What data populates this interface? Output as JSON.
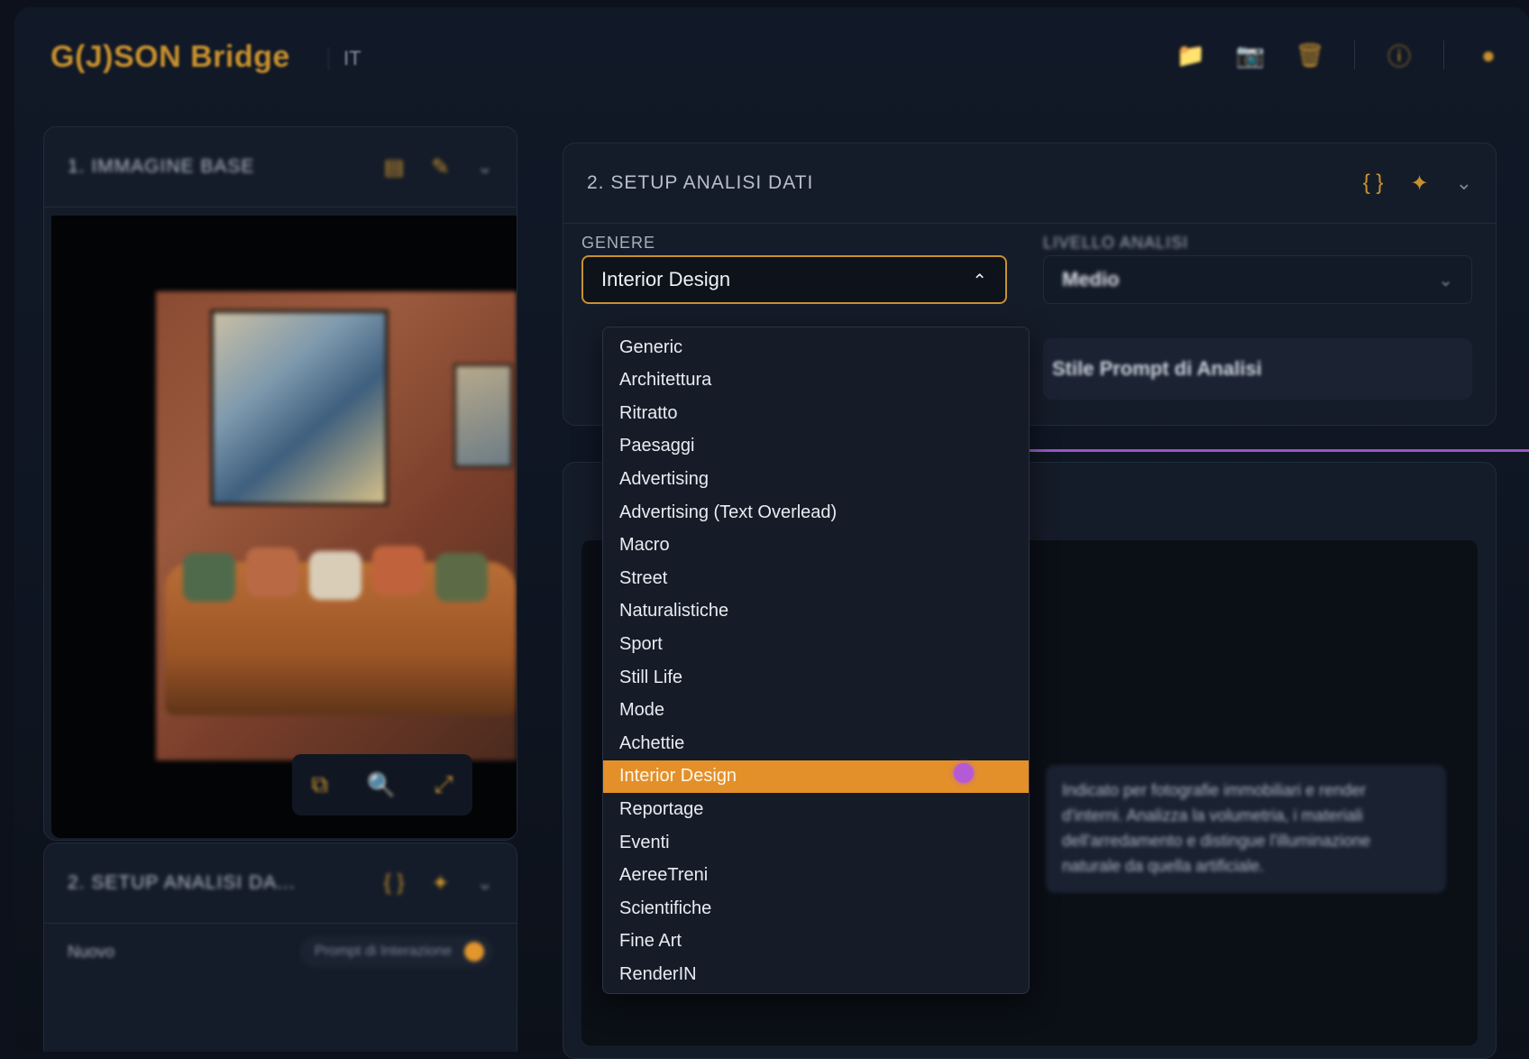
{
  "app": {
    "brand": "G(J)SON Bridge",
    "language": "IT",
    "accent_color": "#c8912e",
    "toolbar_icons": [
      "folder-icon",
      "camera-icon",
      "trash-icon",
      "info-icon",
      "user-icon"
    ]
  },
  "image_panel": {
    "title": "1. IMMAGINE BASE",
    "image_alt": "Living room with leather sofa, brick wall and abstract painting",
    "tools": [
      "crop-icon",
      "zoom-icon",
      "expand-icon"
    ]
  },
  "mini_panel": {
    "title": "2. SETUP ANALISI DA...",
    "label": "Nuovo",
    "pill_text": "Prompt di Interazione"
  },
  "setup_panel": {
    "title": "2. SETUP ANALISI DATI",
    "genere_label": "GENERE",
    "genere_value": "Interior Design",
    "livello_label": "LIVELLO ANALISI",
    "livello_value": "Medio",
    "prompt_button": "Stile Prompt di Analisi"
  },
  "dropdown": {
    "options": [
      "Generic",
      "Architettura",
      "Ritratto",
      "Paesaggi",
      "Advertising",
      "Advertising (Text Overlead)",
      "Macro",
      "Street",
      "Naturalistiche",
      "Sport",
      "Still Life",
      "Mode",
      "Achettie",
      "Interior Design",
      "Reportage",
      "Eventi",
      "AereeTreni",
      "Scientifiche",
      "Fine Art",
      "RenderIN"
    ],
    "selected_index": 13,
    "highlight_color": "#e3902a"
  },
  "tooltip": {
    "text": "Indicato per fotografie immobiliari e render d'interni. Analizza la volumetria, i materiali dell'arredamento e distingue l'illuminazione naturale da quella artificiale."
  },
  "connector_color": "#9a56c4"
}
